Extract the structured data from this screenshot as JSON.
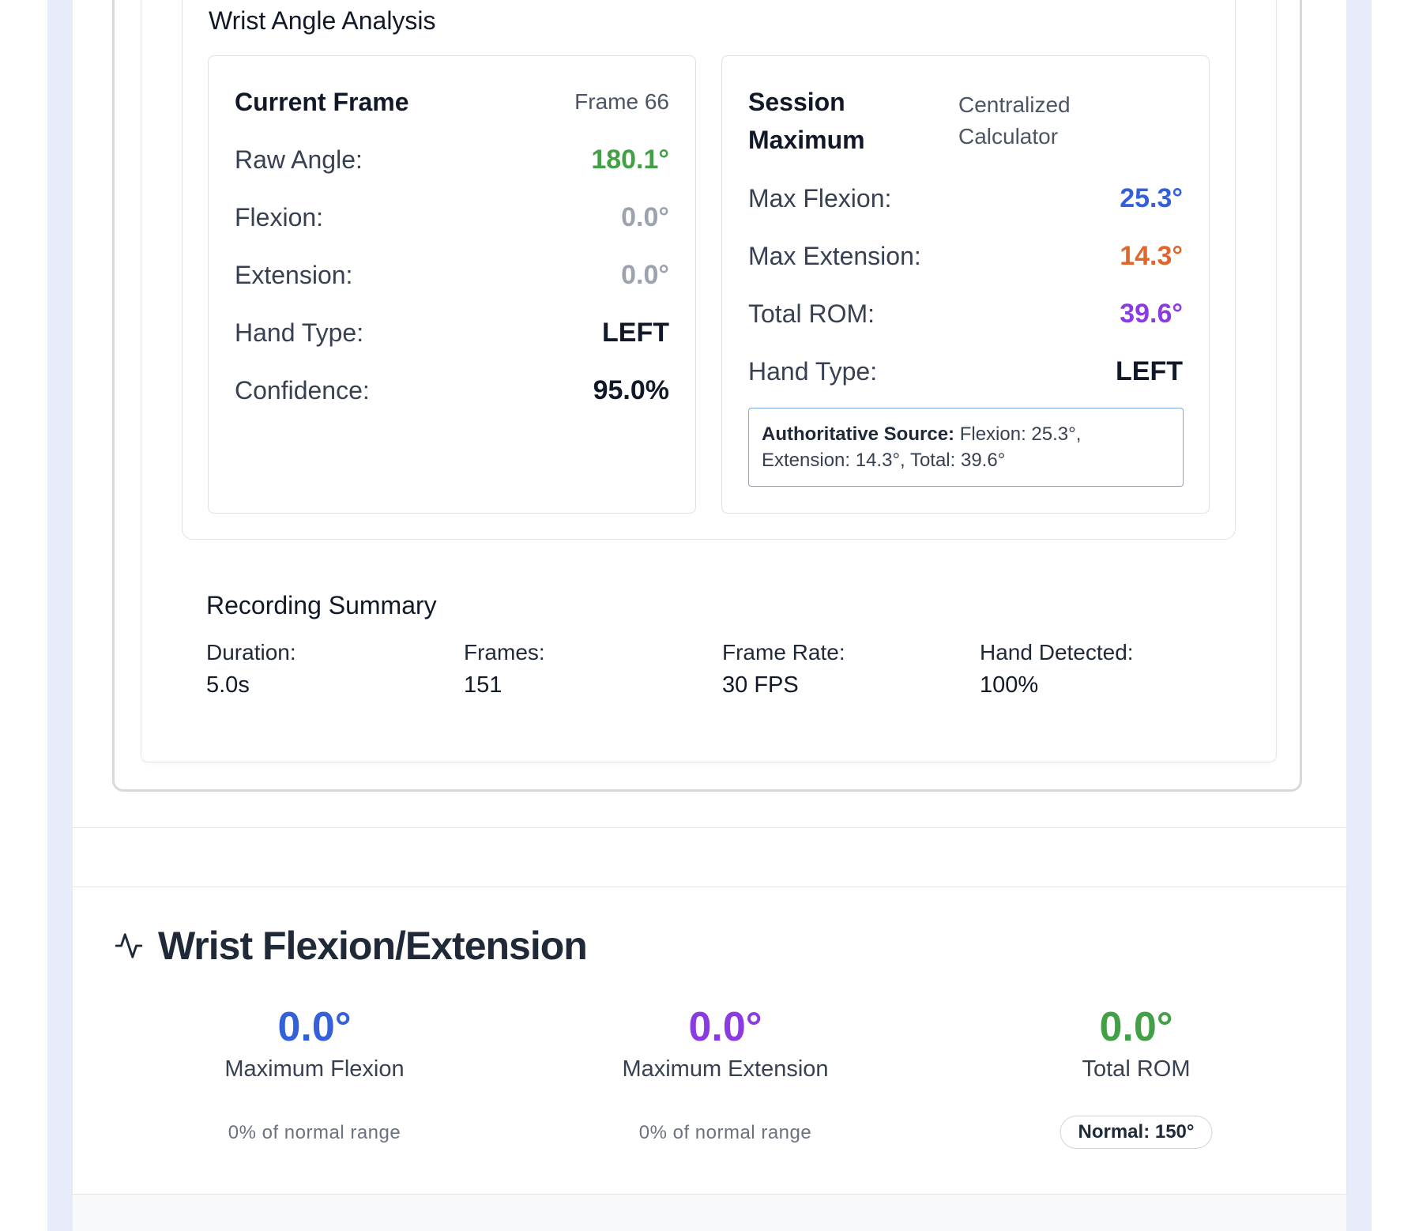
{
  "wrist_angle_analysis": {
    "title": "Wrist Angle Analysis",
    "current_frame": {
      "title": "Current Frame",
      "frame_label": "Frame 66",
      "rows": [
        {
          "label": "Raw Angle:",
          "value": "180.1°",
          "color": "#43a047"
        },
        {
          "label": "Flexion:",
          "value": "0.0°",
          "color": "#9ca3af"
        },
        {
          "label": "Extension:",
          "value": "0.0°",
          "color": "#9ca3af"
        },
        {
          "label": "Hand Type:",
          "value": "LEFT",
          "color": "#111827"
        },
        {
          "label": "Confidence:",
          "value": "95.0%",
          "color": "#111827"
        }
      ]
    },
    "session_maximum": {
      "title_line1": "Session",
      "title_line2": "Maximum",
      "source_line1": "Centralized",
      "source_line2": "Calculator",
      "rows": [
        {
          "label": "Max Flexion:",
          "value": "25.3°",
          "color": "#3461d9"
        },
        {
          "label": "Max Extension:",
          "value": "14.3°",
          "color": "#e0662c"
        },
        {
          "label": "Total ROM:",
          "value": "39.6°",
          "color": "#8a3be2"
        },
        {
          "label": "Hand Type:",
          "value": "LEFT",
          "color": "#111827"
        }
      ],
      "authoritative_label": "Authoritative Source:",
      "authoritative_text_1": " Flexion: 25.3°,",
      "authoritative_text_2": "Extension: 14.3°, Total: 39.6°"
    }
  },
  "recording_summary": {
    "title": "Recording Summary",
    "items": [
      {
        "label": "Duration:",
        "value": "5.0s"
      },
      {
        "label": "Frames:",
        "value": "151"
      },
      {
        "label": "Frame Rate:",
        "value": "30 FPS"
      },
      {
        "label": "Hand Detected:",
        "value": "100%"
      }
    ]
  },
  "wrist_flexion_extension": {
    "icon": "activity-icon",
    "title": "Wrist Flexion/Extension",
    "metrics": [
      {
        "value": "0.0°",
        "label": "Maximum Flexion",
        "note": "0% of normal range",
        "color": "#3461d9"
      },
      {
        "value": "0.0°",
        "label": "Maximum Extension",
        "note": "0% of normal range",
        "color": "#8a3be2"
      },
      {
        "value": "0.0°",
        "label": "Total ROM",
        "badge": "Normal: 150°",
        "color": "#43a047"
      }
    ]
  }
}
